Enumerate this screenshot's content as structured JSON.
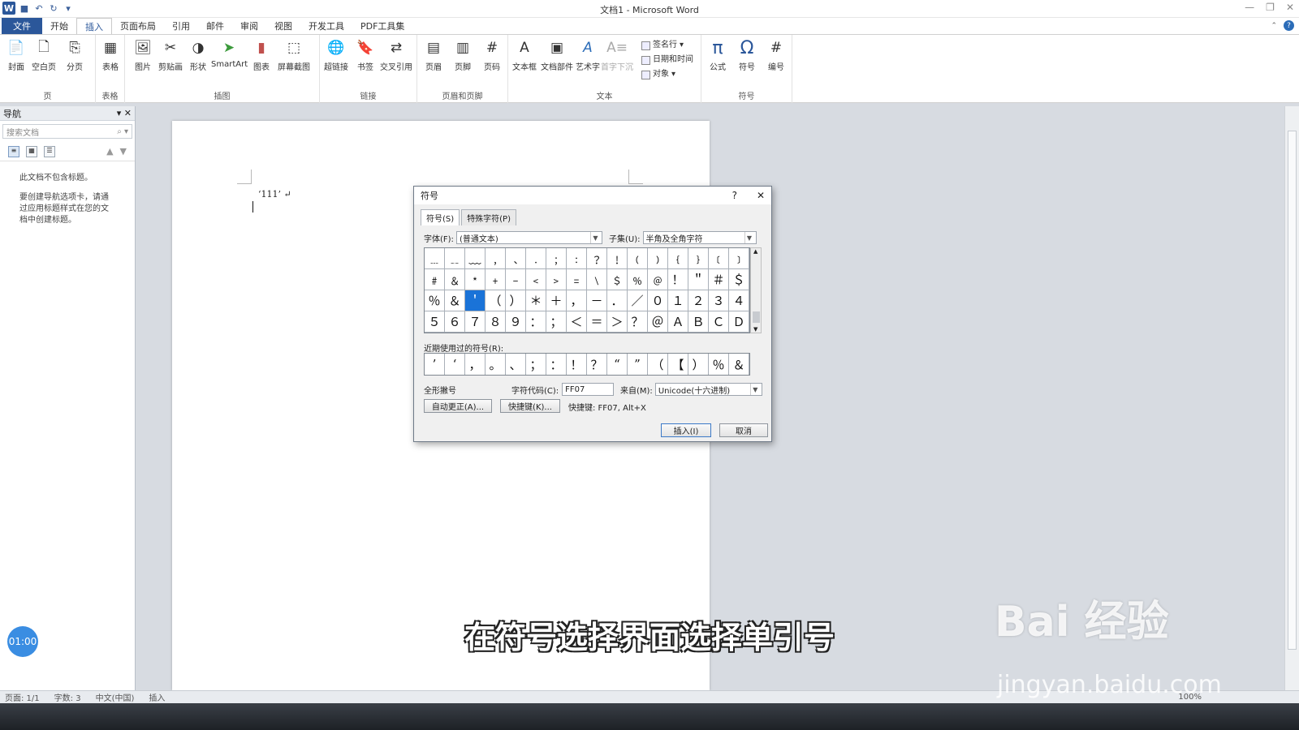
{
  "window": {
    "title": "文档1 - Microsoft Word"
  },
  "tabs": [
    {
      "label": "文件"
    },
    {
      "label": "开始"
    },
    {
      "label": "插入"
    },
    {
      "label": "页面布局"
    },
    {
      "label": "引用"
    },
    {
      "label": "邮件"
    },
    {
      "label": "审阅"
    },
    {
      "label": "视图"
    },
    {
      "label": "开发工具"
    },
    {
      "label": "PDF工具集"
    }
  ],
  "ribbon": {
    "groups": {
      "page": "页",
      "table": "表格",
      "illustrations": "插图",
      "links": "链接",
      "header_footer": "页眉和页脚",
      "text": "文本",
      "symbols": "符号"
    },
    "buttons": {
      "cover": "封面",
      "blank": "空白页",
      "pagebreak": "分页",
      "table": "表格",
      "picture": "图片",
      "clipart": "剪贴画",
      "shapes": "形状",
      "smartart": "SmartArt",
      "chart": "图表",
      "screenshot": "屏幕截图",
      "hyperlink": "超链接",
      "bookmark": "书签",
      "crossref": "交叉引用",
      "header": "页眉",
      "footer": "页脚",
      "pagenum": "页码",
      "textbox": "文本框",
      "quickparts": "文档部件",
      "wordart": "艺术字",
      "dropcap": "首字下沉",
      "signature": "签名行",
      "datetime": "日期和时间",
      "object": "对象",
      "equation": "公式",
      "symbol": "符号",
      "number": "编号"
    }
  },
  "nav": {
    "title": "导航",
    "search_placeholder": "搜索文档",
    "msg1": "此文档不包含标题。",
    "msg2": "要创建导航选项卡，请通过应用标题样式在您的文档中创建标题。",
    "timer": "01:00"
  },
  "document": {
    "text": "‘111’ ↵"
  },
  "status": {
    "page": "页面: 1/1",
    "words": "字数: 3",
    "lang": "中文(中国)",
    "mode": "插入",
    "zoom": "100%"
  },
  "dialog": {
    "title": "符号",
    "help": "?",
    "tab_symbols": "符号(S)",
    "tab_special": "特殊字符(P)",
    "font_label": "字体(F):",
    "font_value": "(普通文本)",
    "subset_label": "子集(U):",
    "subset_value": "半角及全角字符",
    "symbols": [
      "﹍",
      "﹎",
      "﹏",
      "﹐",
      "﹑",
      "﹒",
      "﹔",
      "﹕",
      "﹖",
      "﹗",
      "﹙",
      "﹚",
      "﹛",
      "﹜",
      "﹝",
      "﹞",
      "﹟",
      "﹠",
      "﹡",
      "﹢",
      "﹣",
      "﹤",
      "﹥",
      "﹦",
      "﹨",
      "﹩",
      "﹪",
      "﹫",
      "！",
      "＂",
      "＃",
      "＄",
      "％",
      "＆",
      "＇",
      "（",
      "）",
      "＊",
      "＋",
      "，",
      "－",
      "．",
      "／",
      "０",
      "１",
      "２",
      "３",
      "４",
      "５",
      "６",
      "７",
      "８",
      "９",
      "：",
      "；",
      "＜",
      "＝",
      "＞",
      "？",
      "＠",
      "Ａ",
      "Ｂ",
      "Ｃ",
      "Ｄ"
    ],
    "selected_index": 34,
    "recent_label": "近期使用过的符号(R):",
    "recent": [
      "’",
      "‘",
      "，",
      "。",
      "、",
      "；",
      "：",
      "！",
      "？",
      "“",
      "”",
      "（",
      "【",
      "）",
      "％",
      "＆"
    ],
    "char_name": "全形撇号",
    "code_label": "字符代码(C):",
    "code_value": "FF07",
    "from_label": "来自(M):",
    "from_value": "Unicode(十六进制)",
    "autocorrect": "自动更正(A)...",
    "shortcut_key": "快捷键(K)...",
    "shortcut_text": "快捷键: FF07, Alt+X",
    "insert": "插入(I)",
    "cancel": "取消"
  },
  "overlay": {
    "subtitle": "在符号选择界面选择单引号",
    "watermark": "Bai 经验",
    "watermark_url": "jingyan.baidu.com"
  }
}
